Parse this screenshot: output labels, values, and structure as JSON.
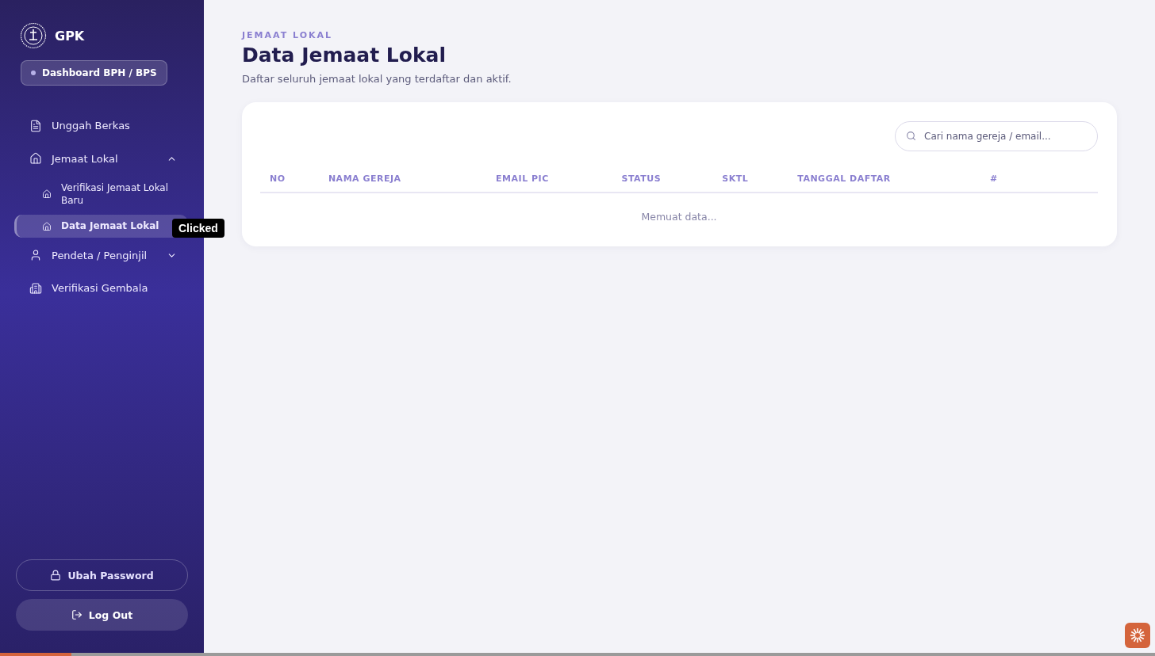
{
  "sidebar": {
    "brand": "GPK",
    "role_badge": "Dashboard BPH / BPS",
    "items": [
      {
        "label": "Unggah Berkas",
        "kind": "file",
        "selected": false
      },
      {
        "label": "Jemaat Lokal",
        "kind": "church",
        "expanded": true,
        "selected": false,
        "children": [
          {
            "label": "Verifikasi Jemaat Lokal Baru",
            "selected": false
          },
          {
            "label": "Data Jemaat Lokal",
            "selected": true
          }
        ]
      },
      {
        "label": "Pendeta / Penginjil",
        "kind": "person",
        "expanded": false,
        "selected": false
      },
      {
        "label": "Verifikasi Gembala",
        "kind": "building",
        "selected": false
      }
    ],
    "change_password": "Ubah Password",
    "logout": "Log Out"
  },
  "tooltip": "Clicked",
  "page": {
    "eyebrow": "JEMAAT LOKAL",
    "title": "Data Jemaat Lokal",
    "subtitle": "Daftar seluruh jemaat lokal yang terdaftar dan aktif."
  },
  "search": {
    "placeholder": "Cari nama gereja / email..."
  },
  "table": {
    "columns": [
      "NO",
      "NAMA GEREJA",
      "EMAIL PIC",
      "STATUS",
      "SKTL",
      "TANGGAL DAFTAR",
      "#"
    ],
    "loading": "Memuat data..."
  },
  "playback": {
    "level": 0.062
  }
}
